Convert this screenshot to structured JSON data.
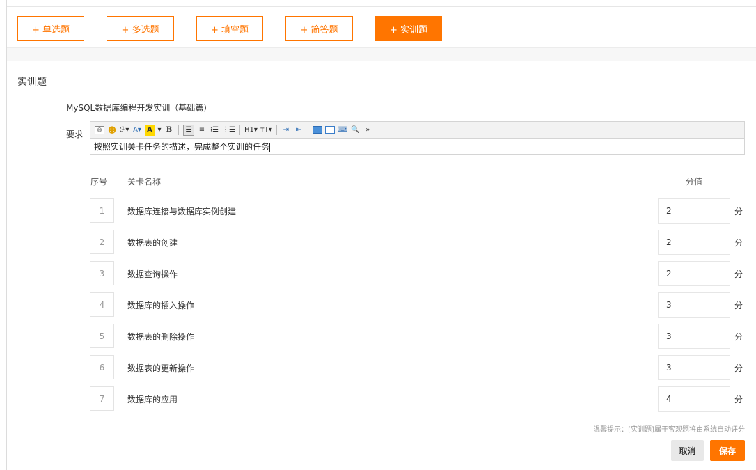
{
  "question_types": [
    {
      "label": "+ 单选题",
      "active": false
    },
    {
      "label": "+ 多选题",
      "active": false
    },
    {
      "label": "+ 填空题",
      "active": false
    },
    {
      "label": "+ 简答题",
      "active": false
    },
    {
      "label": "+ 实训题",
      "active": true
    }
  ],
  "section_title": "实训题",
  "shixun_name": "MySQL数据库编程开发实训（基础篇）",
  "requirement": {
    "label": "要求",
    "content": "按照实训关卡任务的描述，完成整个实训的任务"
  },
  "toolbar": {
    "font_a": "A",
    "highlight_a": "A",
    "bold": "B",
    "heading": "H1",
    "text_size": "тT",
    "more": "»"
  },
  "table": {
    "headers": {
      "index": "序号",
      "name": "关卡名称",
      "score": "分值"
    },
    "unit": "分",
    "rows": [
      {
        "index": "1",
        "name": "数据库连接与数据库实例创建",
        "score": "2"
      },
      {
        "index": "2",
        "name": "数据表的创建",
        "score": "2"
      },
      {
        "index": "3",
        "name": "数据查询操作",
        "score": "2"
      },
      {
        "index": "4",
        "name": "数据库的插入操作",
        "score": "3"
      },
      {
        "index": "5",
        "name": "数据表的删除操作",
        "score": "3"
      },
      {
        "index": "6",
        "name": "数据表的更新操作",
        "score": "3"
      },
      {
        "index": "7",
        "name": "数据库的应用",
        "score": "4"
      }
    ]
  },
  "tip": "温馨提示：[实训题]属于客观题将由系统自动评分",
  "actions": {
    "cancel": "取消",
    "save": "保存"
  },
  "colors": {
    "accent": "#ff7500",
    "cancel_bg": "#e8e8e8"
  }
}
